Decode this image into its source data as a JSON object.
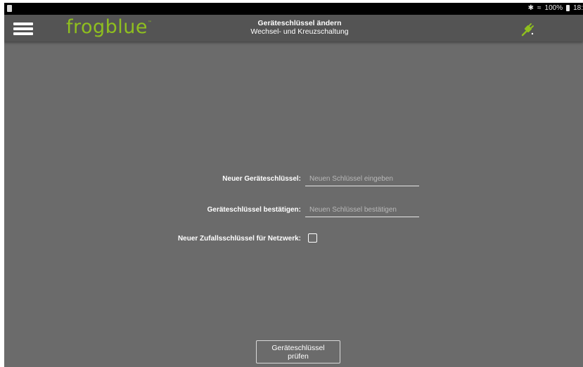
{
  "status_bar": {
    "bluetooth_icon": "bluetooth-icon",
    "wifi_icon": "wifi-icon",
    "battery_text": "100%",
    "battery_icon": "battery-icon",
    "time": "18:"
  },
  "app_bar": {
    "menu_icon": "hamburger-menu-icon",
    "logo_text": "frogblue",
    "logo_tm": "™",
    "title": "Geräteschlüssel ändern",
    "subtitle": "Wechsel- und Kreuzschaltung",
    "status_icon": "plug-connected-icon",
    "status_icon_color": "#8fbf1f"
  },
  "form": {
    "new_key_label": "Neuer Geräteschlüssel:",
    "new_key_placeholder": "Neuen Schlüssel eingeben",
    "new_key_value": "",
    "confirm_key_label": "Geräteschlüssel bestätigen:",
    "confirm_key_placeholder": "Neuen Schlüssel bestätigen",
    "confirm_key_value": "",
    "random_key_label": "Neuer Zufallsschlüssel für Netzwerk:",
    "random_key_checked": false
  },
  "actions": {
    "check_button_label": "Geräteschlüssel prüfen"
  },
  "colors": {
    "background": "#6b6b6b",
    "app_bar": "#545454",
    "brand_green": "#8fbf1f"
  }
}
